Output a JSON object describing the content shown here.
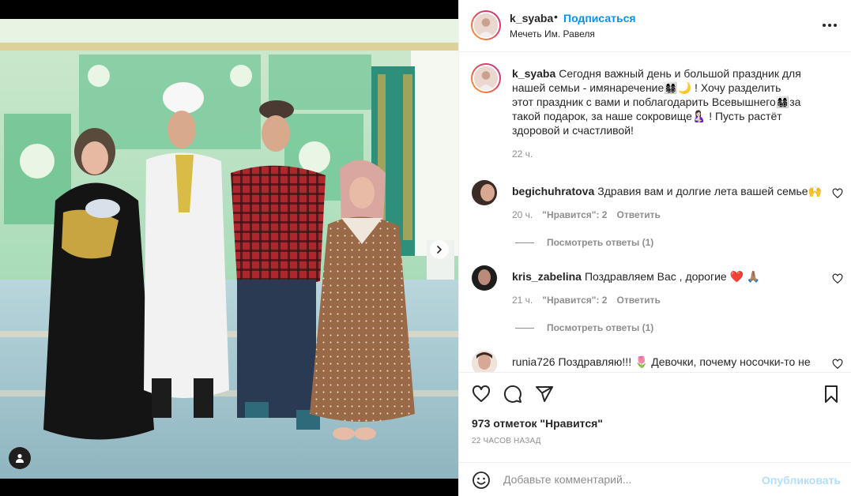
{
  "post": {
    "username": "k_syaba",
    "separator": "•",
    "follow_label": "Подписаться",
    "location": "Мечеть Им. Равеля"
  },
  "caption": {
    "username": "k_syaba",
    "text": "Сегодня важный день и большой праздник для нашей семьи - имянаречение👩‍👩‍👧‍👦🌙 ! Хочу разделить этот праздник с вами и поблагодарить Всевышнего👩‍👩‍👧‍👦за такой подарок, за наше сокровище🤱🏻 ! Пусть растёт здоровой и счастливой!",
    "time": "22 ч."
  },
  "comments": [
    {
      "username": "begichuhratova",
      "text": "Здравия вам и долгие лета вашей семье🙌",
      "time": "20 ч.",
      "likes": "\"Нравится\": 2",
      "reply": "Ответить",
      "view_replies": "Посмотреть ответы (1)"
    },
    {
      "username": "kris_zabelina",
      "text": "Поздравляем Вас , дорогие ❤️ 🙏🏽",
      "time": "21 ч.",
      "likes": "\"Нравится\": 2",
      "reply": "Ответить",
      "view_replies": "Посмотреть ответы (1)"
    },
    {
      "username": "runia726",
      "text": "Поздравляю!!! 🌷 Девочки, почему носочки-то не",
      "time": "",
      "likes": "",
      "reply": "",
      "view_replies": ""
    }
  ],
  "actions": {
    "likes_count": "973 отметок \"Нравится\"",
    "posted": "22 ЧАСОВ НАЗАД",
    "icons": [
      "heart-icon",
      "comment-icon",
      "share-icon",
      "bookmark-icon"
    ]
  },
  "add_comment": {
    "placeholder": "Добавьте комментарий...",
    "publish_label": "Опубликовать"
  },
  "carousel": {
    "slide_count": 4,
    "active_index": 0
  },
  "colors": {
    "accent": "#0095f6",
    "publish_disabled": "#b2dffc",
    "muted": "#8e8e8e",
    "text": "#262626",
    "like_red": "#ed4956"
  }
}
